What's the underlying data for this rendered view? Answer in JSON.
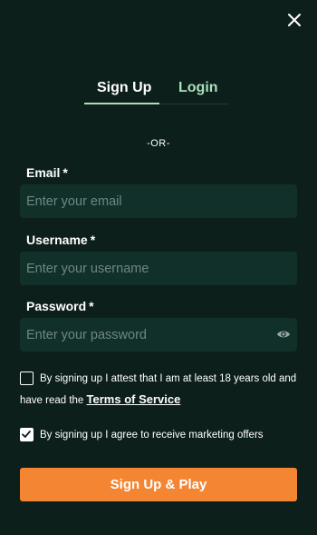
{
  "dialog": {
    "close_icon": "close-icon"
  },
  "tabs": [
    {
      "label": "Sign Up",
      "active": true
    },
    {
      "label": "Login",
      "active": false
    }
  ],
  "separator": "-OR-",
  "form": {
    "email": {
      "label": "Email",
      "required_mark": "*",
      "placeholder": "Enter your email",
      "value": ""
    },
    "username": {
      "label": "Username",
      "required_mark": "*",
      "placeholder": "Enter your username",
      "value": ""
    },
    "password": {
      "label": "Password",
      "required_mark": "*",
      "placeholder": "Enter your password",
      "value": "",
      "toggle_icon": "eye-icon"
    }
  },
  "consents": {
    "age": {
      "checked": false,
      "line1": "By signing up I attest that I am at least 18 years old and",
      "line2_prefix": "have read the ",
      "link_text": "Terms of Service"
    },
    "marketing": {
      "checked": true,
      "text": "By signing up I agree to receive marketing offers"
    }
  },
  "submit": {
    "label": "Sign Up & Play"
  },
  "colors": {
    "background": "#0d1f1a",
    "field_background": "#12302a",
    "accent_green": "#a8e0bd",
    "cta_orange": "#f48633"
  }
}
